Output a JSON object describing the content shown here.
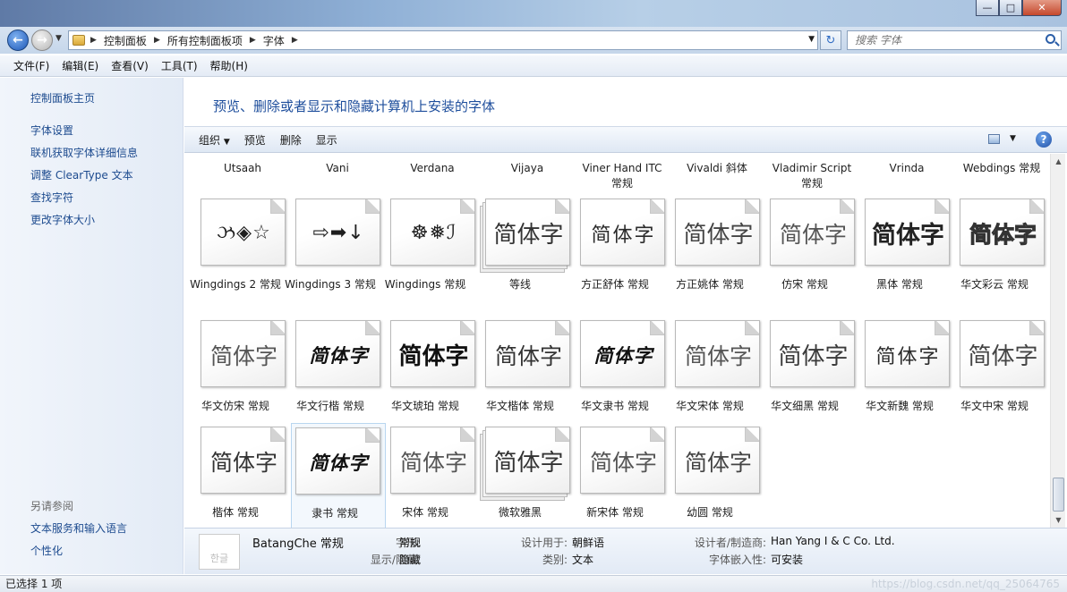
{
  "window": {
    "controls": [
      "—",
      "□",
      "✕"
    ]
  },
  "address": {
    "breadcrumb": [
      "控制面板",
      "所有控制面板项",
      "字体"
    ],
    "search_placeholder": "搜索 字体"
  },
  "menu": [
    "文件(F)",
    "编辑(E)",
    "查看(V)",
    "工具(T)",
    "帮助(H)"
  ],
  "sidebar": {
    "home": "控制面板主页",
    "links": [
      "字体设置",
      "联机获取字体详细信息",
      "调整 ClearType 文本",
      "查找字符",
      "更改字体大小"
    ],
    "see_also_title": "另请参阅",
    "see_also": [
      "文本服务和输入语言",
      "个性化"
    ]
  },
  "heading": "预览、删除或者显示和隐藏计算机上安装的字体",
  "toolbar": {
    "organize": "组织",
    "preview": "预览",
    "delete": "删除",
    "show": "显示"
  },
  "top_row_labels": [
    "Utsaah",
    "Vani",
    "Verdana",
    "Vijaya",
    "Viner Hand ITC 常规",
    "Vivaldi 斜体",
    "Vladimir Script 常规",
    "Vrinda",
    "Webdings 常规"
  ],
  "fonts": [
    {
      "name": "Wingdings 2 常规",
      "sample": "ઝ◈☆"
    },
    {
      "name": "Wingdings 3 常规",
      "sample": "⇨➡↓"
    },
    {
      "name": "Wingdings 常规",
      "sample": "☸❅ℐ"
    },
    {
      "name": "等线",
      "sample": "简体字"
    },
    {
      "name": "方正舒体 常规",
      "sample": "简体字"
    },
    {
      "name": "方正姚体 常规",
      "sample": "简体字"
    },
    {
      "name": "仿宋 常规",
      "sample": "简体字"
    },
    {
      "name": "黑体 常规",
      "sample": "简体字"
    },
    {
      "name": "华文彩云 常规",
      "sample": "简体字"
    },
    {
      "name": "华文仿宋 常规",
      "sample": "简体字"
    },
    {
      "name": "华文行楷 常规",
      "sample": "简体字"
    },
    {
      "name": "华文琥珀 常规",
      "sample": "简体字"
    },
    {
      "name": "华文楷体 常规",
      "sample": "简体字"
    },
    {
      "name": "华文隶书 常规",
      "sample": "简体字"
    },
    {
      "name": "华文宋体 常规",
      "sample": "简体字"
    },
    {
      "name": "华文细黑 常规",
      "sample": "简体字"
    },
    {
      "name": "华文新魏 常规",
      "sample": "简体字"
    },
    {
      "name": "华文中宋 常规",
      "sample": "简体字"
    },
    {
      "name": "楷体 常规",
      "sample": "简体字"
    },
    {
      "name": "隶书 常规",
      "sample": "简体字"
    },
    {
      "name": "宋体 常规",
      "sample": "简体字"
    },
    {
      "name": "微软雅黑",
      "sample": "简体字"
    },
    {
      "name": "新宋体 常规",
      "sample": "简体字"
    },
    {
      "name": "幼圆 常规",
      "sample": "简体字"
    }
  ],
  "details": {
    "thumb_text": "한글",
    "name": "BatangChe 常规",
    "style_label": "字形:",
    "style_value": "常规",
    "visibility_label": "显示/隐藏:",
    "visibility_value": "隐藏",
    "designed_for_label": "设计用于:",
    "designed_for_value": "朝鲜语",
    "category_label": "类别:",
    "category_value": "文本",
    "designer_label": "设计者/制造商:",
    "designer_value": "Han Yang I & C Co. Ltd.",
    "embed_label": "字体嵌入性:",
    "embed_value": "可安装"
  },
  "status": {
    "text": "已选择 1 项",
    "watermark": "https://blog.csdn.net/qq_25064765"
  }
}
